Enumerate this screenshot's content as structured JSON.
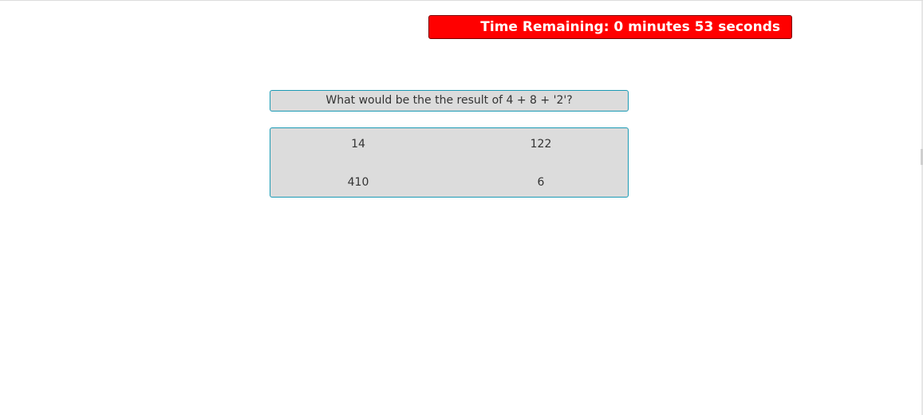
{
  "timer": {
    "text": "Time Remaining: 0 minutes 53 seconds",
    "background_color": "#ff0000"
  },
  "question": {
    "text": "What would be the the result of 4 + 8 + '2'?"
  },
  "answers": [
    {
      "label": "14"
    },
    {
      "label": "122"
    },
    {
      "label": "410"
    },
    {
      "label": "6"
    }
  ],
  "colors": {
    "box_border": "#1b9ab4",
    "box_background": "#dcdcdc"
  }
}
